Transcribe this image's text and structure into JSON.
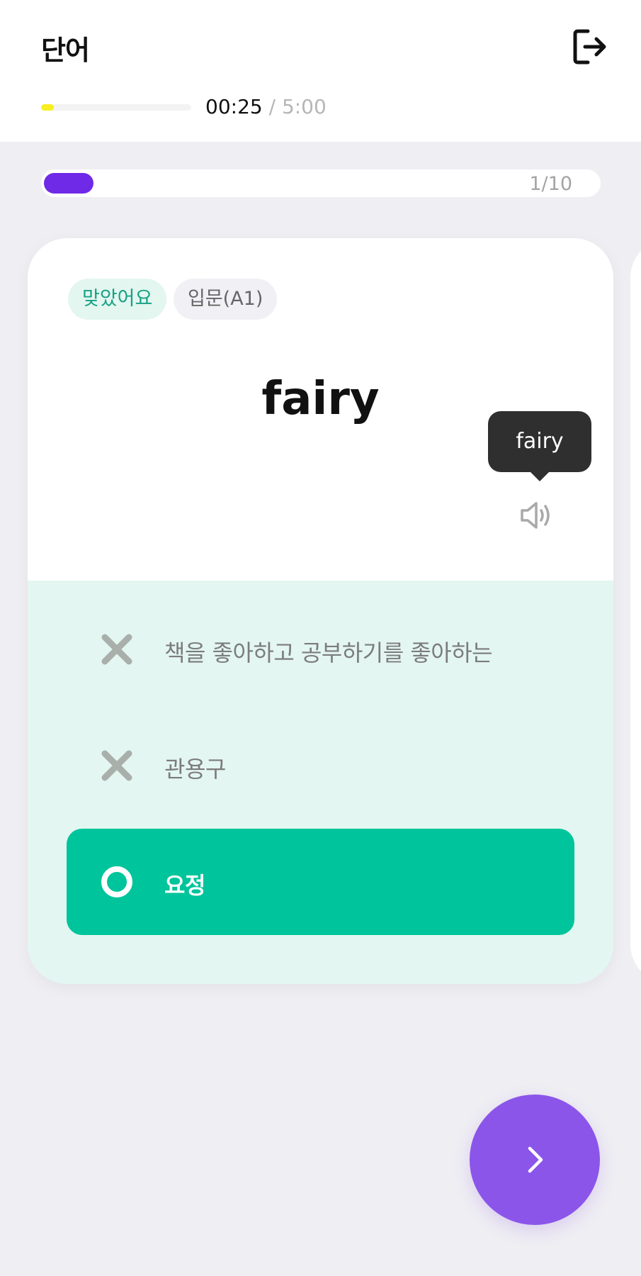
{
  "header": {
    "title": "단어",
    "exit_icon": "logout-icon"
  },
  "timer": {
    "elapsed": "00:25",
    "separator": " / ",
    "total": "5:00",
    "progress_fraction": 0.083,
    "bar_color": "#f7ef1f"
  },
  "quiz_progress": {
    "label": "1/10",
    "current": 1,
    "total": 10,
    "bar_color": "#6e2ae6"
  },
  "card": {
    "badges": {
      "result": "맞았어요",
      "level": "입문(A1)"
    },
    "word": "fairy",
    "tooltip": "fairy",
    "speaker_icon": "speaker-icon",
    "options": [
      {
        "text": "책을 좋아하고 공부하기를 좋아하는",
        "state": "wrong",
        "icon": "x-icon"
      },
      {
        "text": "관용구",
        "state": "wrong",
        "icon": "x-icon"
      },
      {
        "text": "요정",
        "state": "correct",
        "icon": "circle-icon"
      }
    ]
  },
  "colors": {
    "accent": "#8b55ea",
    "correct": "#00c49b",
    "correct_bg": "#e3f6f1"
  },
  "next_icon": "chevron-right-icon"
}
